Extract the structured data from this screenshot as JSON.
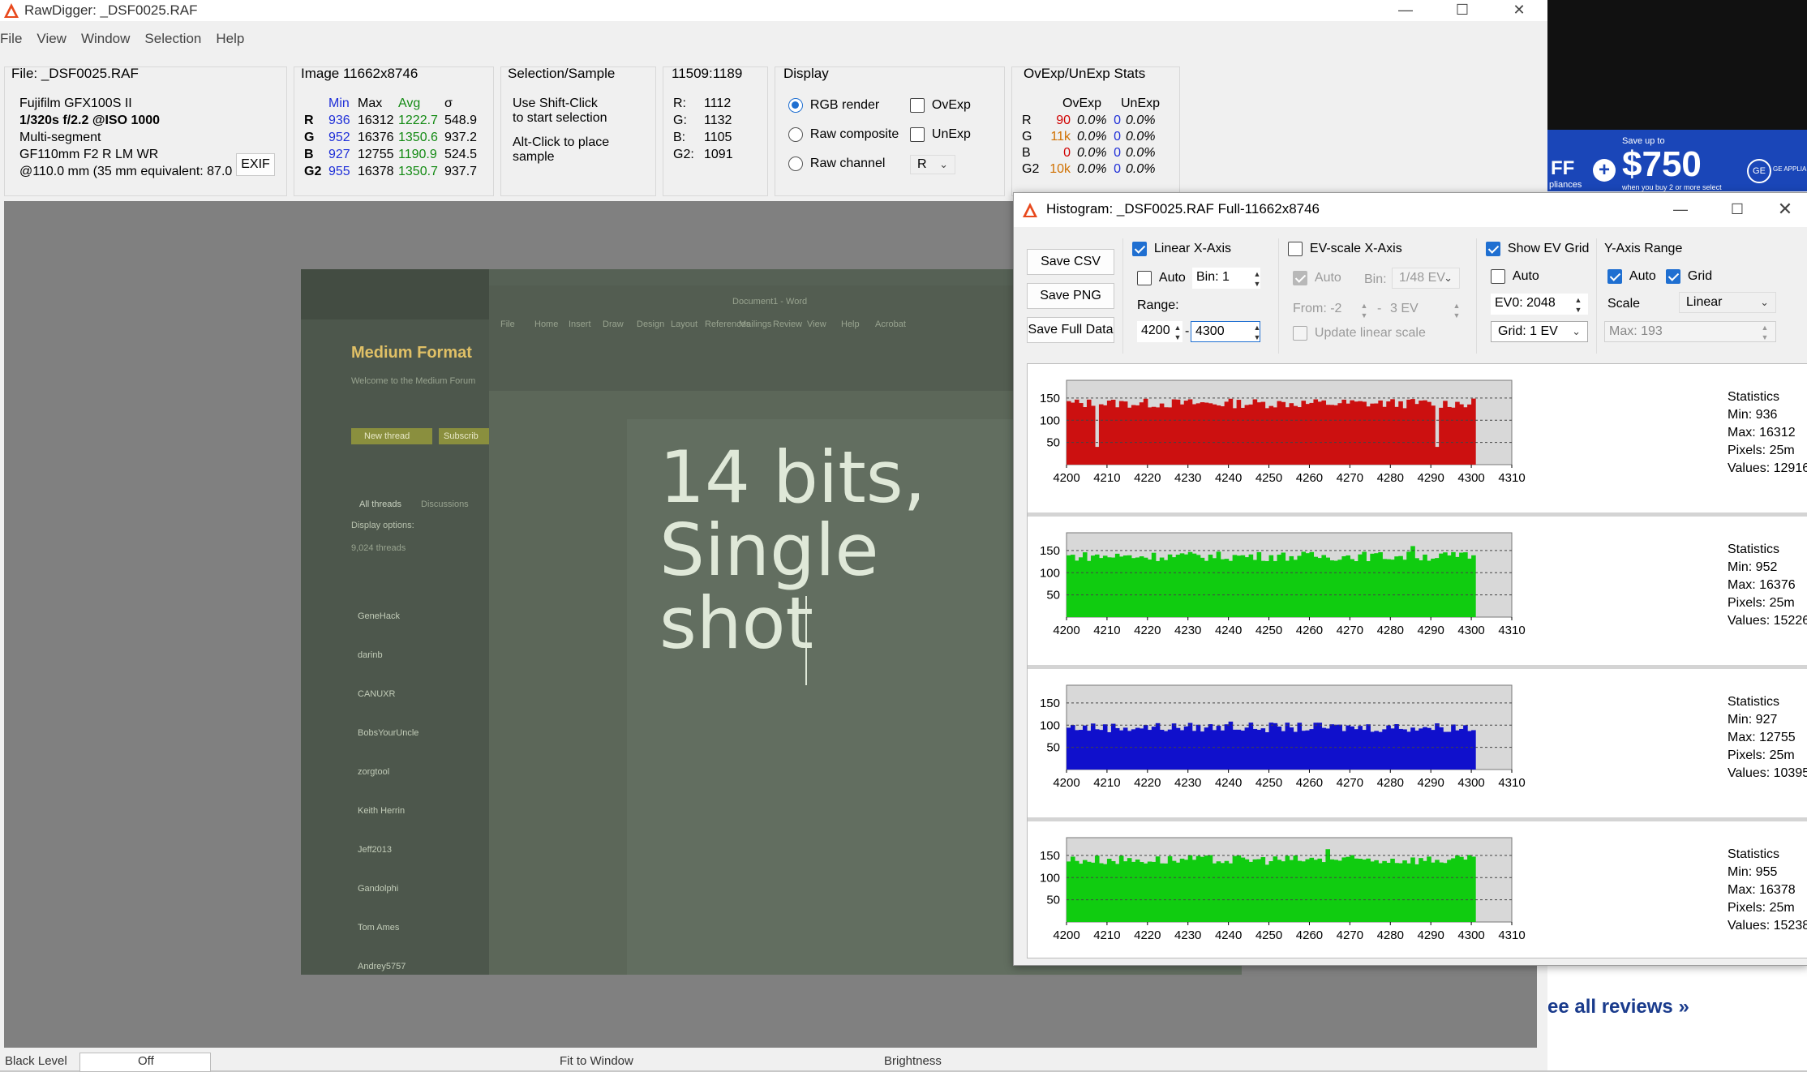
{
  "app": {
    "title": "RawDigger: _DSF0025.RAF",
    "menu": [
      "File",
      "View",
      "Window",
      "Selection",
      "Help"
    ]
  },
  "file_panel": {
    "title": "File: _DSF0025.RAF",
    "camera": "Fujifilm GFX100S II",
    "exposure": "1/320s f/2.2 @ISO 1000",
    "mode": "Multi-segment",
    "lens": "GF110mm F2 R LM WR",
    "focal": "@110.0 mm (35 mm equivalent: 87.0",
    "exif_button": "EXIF"
  },
  "image_panel": {
    "title": "Image 11662x8746",
    "headers": [
      "Min",
      "Max",
      "Avg",
      "σ"
    ],
    "rows": [
      {
        "ch": "R",
        "min": "936",
        "max": "16312",
        "avg": "1222.7",
        "sd": "548.9"
      },
      {
        "ch": "G",
        "min": "952",
        "max": "16376",
        "avg": "1350.6",
        "sd": "937.2"
      },
      {
        "ch": "B",
        "min": "927",
        "max": "12755",
        "avg": "1190.9",
        "sd": "524.5"
      },
      {
        "ch": "G2",
        "min": "955",
        "max": "16378",
        "avg": "1350.7",
        "sd": "937.7"
      }
    ]
  },
  "selection_panel": {
    "title": "Selection/Sample",
    "line1": "Use Shift-Click",
    "line2": "to start selection",
    "line3": "Alt-Click to place",
    "line4": "sample"
  },
  "coord_panel": {
    "title": "11509:1189",
    "rows": [
      {
        "label": "R:",
        "value": "1112"
      },
      {
        "label": "G:",
        "value": "1132"
      },
      {
        "label": "B:",
        "value": "1105"
      },
      {
        "label": "G2:",
        "value": "1091"
      }
    ]
  },
  "display_panel": {
    "title": "Display",
    "rgb_render": "RGB render",
    "raw_composite": "Raw composite",
    "raw_channel": "Raw channel",
    "ovexp": "OvExp",
    "unexp": "UnExp",
    "channel_value": "R"
  },
  "ovexp_panel": {
    "title": "OvExp/UnExp Stats",
    "headers": [
      "OvExp",
      "UnExp"
    ],
    "rows": [
      {
        "ch": "R",
        "ov": "90",
        "ovp": "0.0%",
        "un": "0",
        "unp": "0.0%"
      },
      {
        "ch": "G",
        "ov": "11k",
        "ovp": "0.0%",
        "un": "0",
        "unp": "0.0%"
      },
      {
        "ch": "B",
        "ov": "0",
        "ovp": "0.0%",
        "un": "0",
        "unp": "0.0%"
      },
      {
        "ch": "G2",
        "ov": "10k",
        "ovp": "0.0%",
        "un": "0",
        "unp": "0.0%"
      }
    ]
  },
  "photo": {
    "line1": "14 bits,",
    "line2": "Single",
    "line3": "shot",
    "web_title": "Medium Format",
    "web_welcome": "Welcome to the Medium Forum",
    "new_thread": "New thread",
    "subscribe": "Subscrib",
    "threads": "9,024 threads",
    "display_options": "Display options:",
    "tabs": [
      "All threads",
      "Discussions"
    ],
    "thread_users": [
      "GeneHack",
      "darinb",
      "CANUXR",
      "BobsYourUncle",
      "zorgtool",
      "Keith Herrin",
      "Jeff2013",
      "Gandolphi",
      "Tom Ames",
      "Andrey5757"
    ],
    "word_tabs": [
      "File",
      "Home",
      "Insert",
      "Draw",
      "Design",
      "Layout",
      "References",
      "Mailings",
      "Review",
      "View",
      "Help",
      "Acrobat"
    ],
    "word_doc": "Document1 - Word"
  },
  "status_bar": {
    "black_level": "Black Level",
    "black_value": "Off",
    "fit": "Fit to Window",
    "brightness": "Brightness"
  },
  "side": {
    "ad_small": "Save up to",
    "ad_amount": "$750",
    "ad_sub": "when you buy 2 or more select",
    "ad_left": "FF",
    "ad_left2": "pliances",
    "ad_brand": "GE APPLIA",
    "see_all": "ee all reviews »"
  },
  "histogram": {
    "title": "Histogram: _DSF0025.RAF Full-11662x8746",
    "buttons": [
      "Save CSV",
      "Save PNG",
      "Save Full Data"
    ],
    "linear_x": "Linear X-Axis",
    "auto": "Auto",
    "bin": "Bin: 1",
    "range_label": "Range:",
    "range_from": "4200",
    "range_to": "4300",
    "ev_scale": "EV-scale X-Axis",
    "ev_bin_label": "Bin:",
    "ev_bin": "1/48 EV",
    "from_label": "From: -2",
    "from_to": "3 EV",
    "update_linear": "Update linear scale",
    "show_ev_grid": "Show EV Grid",
    "ev0": "EV0: 2048",
    "grid_ev": "Grid: 1 EV",
    "y_axis_range": "Y-Axis Range",
    "grid": "Grid",
    "scale_label": "Scale",
    "scale_value": "Linear",
    "max_label": "Max: 193",
    "colors": {
      "r": "#cc1010",
      "g": "#10cc10",
      "b": "#1010cc",
      "g2": "#10cc10"
    }
  },
  "chart_data": [
    {
      "type": "bar",
      "name": "R histogram",
      "x_ticks": [
        4200,
        4210,
        4220,
        4230,
        4240,
        4250,
        4260,
        4270,
        4280,
        4290,
        4300,
        4310
      ],
      "y_ticks": [
        50,
        100,
        150
      ],
      "xlim": [
        4200,
        4310
      ],
      "ylim": [
        0,
        190
      ],
      "stats": {
        "title": "Statistics",
        "min": "Min: 936",
        "max": "Max: 16312",
        "pixels": "Pixels: 25m",
        "values": "Values: 12916"
      },
      "baseline": 138
    },
    {
      "type": "bar",
      "name": "G histogram",
      "x_ticks": [
        4200,
        4210,
        4220,
        4230,
        4240,
        4250,
        4260,
        4270,
        4280,
        4290,
        4300,
        4310
      ],
      "y_ticks": [
        50,
        100,
        150
      ],
      "xlim": [
        4200,
        4310
      ],
      "ylim": [
        0,
        190
      ],
      "stats": {
        "title": "Statistics",
        "min": "Min: 952",
        "max": "Max: 16376",
        "pixels": "Pixels: 25m",
        "values": "Values: 15226"
      },
      "baseline": 137
    },
    {
      "type": "bar",
      "name": "B histogram",
      "x_ticks": [
        4200,
        4210,
        4220,
        4230,
        4240,
        4250,
        4260,
        4270,
        4280,
        4290,
        4300,
        4310
      ],
      "y_ticks": [
        50,
        100,
        150
      ],
      "xlim": [
        4200,
        4310
      ],
      "ylim": [
        0,
        190
      ],
      "stats": {
        "title": "Statistics",
        "min": "Min: 927",
        "max": "Max: 12755",
        "pixels": "Pixels: 25m",
        "values": "Values: 10395"
      },
      "baseline": 95
    },
    {
      "type": "bar",
      "name": "G2 histogram",
      "x_ticks": [
        4200,
        4210,
        4220,
        4230,
        4240,
        4250,
        4260,
        4270,
        4280,
        4290,
        4300,
        4310
      ],
      "y_ticks": [
        50,
        100,
        150
      ],
      "xlim": [
        4200,
        4310
      ],
      "ylim": [
        0,
        190
      ],
      "stats": {
        "title": "Statistics",
        "min": "Min: 955",
        "max": "Max: 16378",
        "pixels": "Pixels: 25m",
        "values": "Values: 15238"
      },
      "baseline": 140
    }
  ]
}
